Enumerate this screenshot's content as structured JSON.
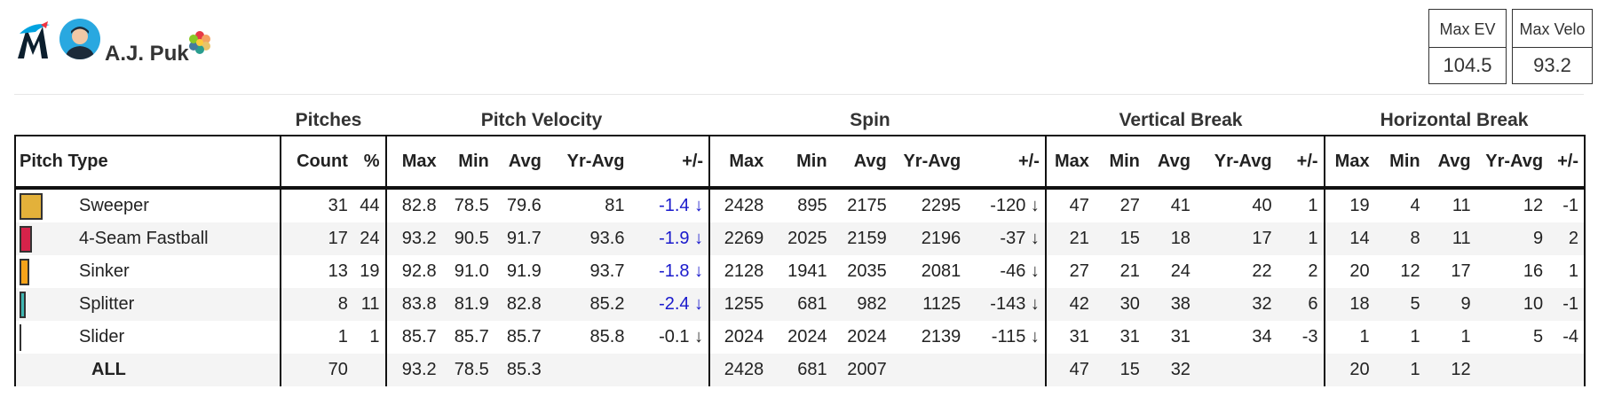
{
  "player": {
    "name": "A.J. Puk",
    "team_icon": "marlins-logo-icon",
    "avatar_icon": "player-headshot-icon",
    "extra_icon": "multicolor-flower-icon"
  },
  "stat_boxes": [
    {
      "label": "Max EV",
      "value": "104.5"
    },
    {
      "label": "Max Velo",
      "value": "93.2"
    }
  ],
  "groups": {
    "pitches": "Pitches",
    "velocity": "Pitch Velocity",
    "spin": "Spin",
    "vbreak": "Vertical Break",
    "hbreak": "Horizontal Break"
  },
  "columns": {
    "pitch_type": "Pitch Type",
    "count": "Count",
    "pct": "%",
    "max": "Max",
    "min": "Min",
    "avg": "Avg",
    "yr_avg": "Yr-Avg",
    "diff": "+/-"
  },
  "rows": [
    {
      "name": "Sweeper",
      "color": "#e3b13a",
      "usage": 44,
      "count": "31",
      "pct": "44",
      "velo": [
        "82.8",
        "78.5",
        "79.6",
        "81",
        "-1.4 ↓"
      ],
      "spin": [
        "2428",
        "895",
        "2175",
        "2295",
        "-120 ↓"
      ],
      "vb": [
        "47",
        "27",
        "41",
        "40",
        "1"
      ],
      "hb": [
        "19",
        "4",
        "11",
        "12",
        "-1"
      ]
    },
    {
      "name": "4-Seam Fastball",
      "color": "#d6234a",
      "usage": 24,
      "count": "17",
      "pct": "24",
      "velo": [
        "93.2",
        "90.5",
        "91.7",
        "93.6",
        "-1.9 ↓"
      ],
      "spin": [
        "2269",
        "2025",
        "2159",
        "2196",
        "-37 ↓"
      ],
      "vb": [
        "21",
        "15",
        "18",
        "17",
        "1"
      ],
      "hb": [
        "14",
        "8",
        "11",
        "9",
        "2"
      ]
    },
    {
      "name": "Sinker",
      "color": "#f5a31a",
      "usage": 19,
      "count": "13",
      "pct": "19",
      "velo": [
        "92.8",
        "91.0",
        "91.9",
        "93.7",
        "-1.8 ↓"
      ],
      "spin": [
        "2128",
        "1941",
        "2035",
        "2081",
        "-46 ↓"
      ],
      "vb": [
        "27",
        "21",
        "24",
        "22",
        "2"
      ],
      "hb": [
        "20",
        "12",
        "17",
        "16",
        "1"
      ]
    },
    {
      "name": "Splitter",
      "color": "#3fb6b2",
      "usage": 11,
      "count": "8",
      "pct": "11",
      "velo": [
        "83.8",
        "81.9",
        "82.8",
        "85.2",
        "-2.4 ↓"
      ],
      "spin": [
        "1255",
        "681",
        "982",
        "1125",
        "-143 ↓"
      ],
      "vb": [
        "42",
        "30",
        "38",
        "32",
        "6"
      ],
      "hb": [
        "18",
        "5",
        "9",
        "10",
        "-1"
      ]
    },
    {
      "name": "Slider",
      "color": "#333333",
      "usage": 1,
      "count": "1",
      "pct": "1",
      "velo": [
        "85.7",
        "85.7",
        "85.7",
        "85.8",
        "-0.1 ↓"
      ],
      "spin": [
        "2024",
        "2024",
        "2024",
        "2139",
        "-115 ↓"
      ],
      "vb": [
        "31",
        "31",
        "31",
        "34",
        "-3"
      ],
      "hb": [
        "1",
        "1",
        "1",
        "5",
        "-4"
      ]
    }
  ],
  "total": {
    "label": "ALL",
    "count": "70",
    "velo": [
      "93.2",
      "78.5",
      "85.3"
    ],
    "spin": [
      "2428",
      "681",
      "2007"
    ],
    "vb": [
      "47",
      "15",
      "32"
    ],
    "hb": [
      "20",
      "1",
      "12"
    ]
  },
  "colors": {
    "velo_diff_blue": "#1a1acc"
  }
}
